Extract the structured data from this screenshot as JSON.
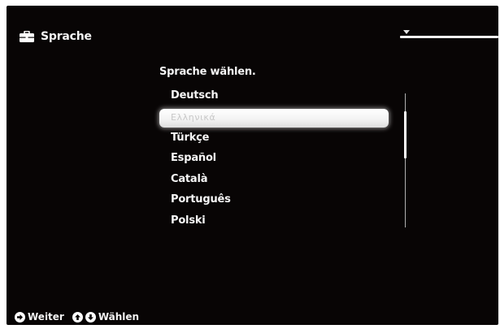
{
  "header": {
    "title": "Sprache",
    "icon": "toolbox-icon"
  },
  "prompt": "Sprache wählen.",
  "languages": [
    {
      "label": "Deutsch",
      "selected": false
    },
    {
      "label": "Ελληνικά",
      "selected": true
    },
    {
      "label": "Türkçe",
      "selected": false
    },
    {
      "label": "Español",
      "selected": false
    },
    {
      "label": "Català",
      "selected": false
    },
    {
      "label": "Português",
      "selected": false
    },
    {
      "label": "Polski",
      "selected": false
    }
  ],
  "footer": {
    "confirm_label": "Weiter",
    "confirm_icon": "arrow-right-circle-icon",
    "select_label": "Wählen",
    "select_icons": [
      "arrow-up-circle-icon",
      "arrow-down-circle-icon"
    ]
  },
  "colors": {
    "background": "#080505",
    "text": "#f4f4f4",
    "highlight": "#ffffff"
  }
}
